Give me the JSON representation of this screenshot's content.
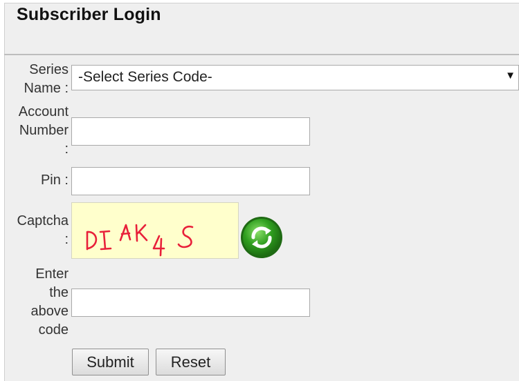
{
  "page": {
    "title": "Subscriber Login"
  },
  "form": {
    "series_label": "Series\nName :",
    "series_selected": "-Select Series Code-",
    "account_label": "Account\nNumber\n:",
    "account_value": "",
    "pin_label": "Pin :",
    "pin_value": "",
    "captcha_label": "Captcha\n:",
    "captcha_text": "DIAK4S",
    "code_label": "Enter\nthe\nabove\ncode",
    "code_value": "",
    "submit_label": "Submit",
    "reset_label": "Reset"
  },
  "icons": {
    "dropdown": "triangle-down-icon",
    "refresh": "refresh-icon"
  },
  "colors": {
    "panel_bg": "#efefef",
    "captcha_bg": "#ffffcc",
    "captcha_ink": "#e8203a",
    "refresh_green": "#2f9e1f"
  }
}
